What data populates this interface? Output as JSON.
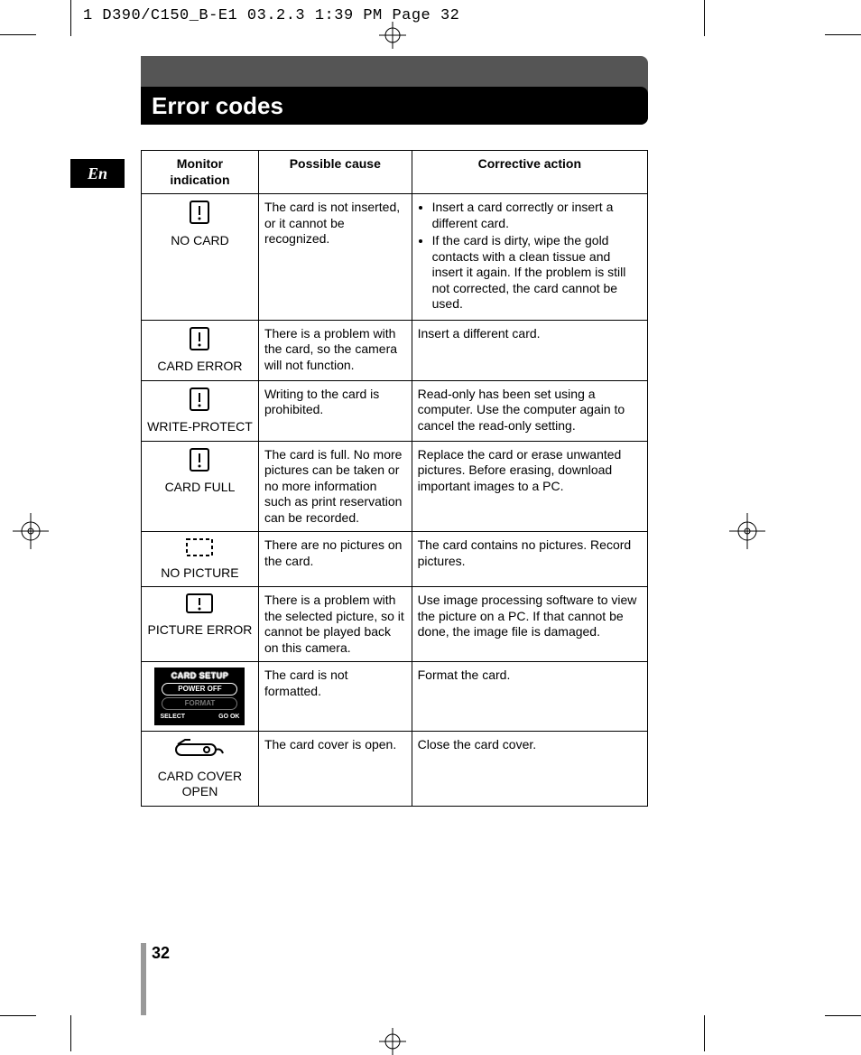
{
  "print_header": "1 D390/C150_B-E1  03.2.3 1:39 PM  Page 32",
  "title": "Error codes",
  "lang_tab": "En",
  "page_number": "32",
  "table": {
    "headers": {
      "monitor": "Monitor indication",
      "cause": "Possible cause",
      "action": "Corrective action"
    },
    "rows": [
      {
        "icon": "warn-card",
        "label": "NO CARD",
        "cause": "The card is not inserted, or it cannot be recognized.",
        "action_bullets": [
          "Insert a card correctly or insert a different card.",
          "If the card is dirty, wipe the gold contacts with a clean tissue and insert it again. If the problem is still not corrected, the card cannot be used."
        ]
      },
      {
        "icon": "warn-card",
        "label": "CARD ERROR",
        "cause": "There is a problem with the card, so the camera will not function.",
        "action": "Insert a different card."
      },
      {
        "icon": "warn-card",
        "label": "WRITE-PROTECT",
        "cause": "Writing to the card is prohibited.",
        "action": "Read-only has been set using a computer. Use the computer again to cancel the read-only setting."
      },
      {
        "icon": "warn-card",
        "label": "CARD FULL",
        "cause": "The card is full. No more pictures can be taken or no more information such as print reservation can be recorded.",
        "action": "Replace the card or erase unwanted pictures. Before erasing, download important images to a PC."
      },
      {
        "icon": "dashed-frame",
        "label": "NO PICTURE",
        "cause": "There are no pictures on the card.",
        "action": "The card contains no pictures. Record pictures."
      },
      {
        "icon": "warn-frame",
        "label": "PICTURE ERROR",
        "cause": "There is a problem with the selected picture, so it cannot be played back on this camera.",
        "action": "Use image processing software to view the picture on a PC. If that cannot be done, the image file is damaged."
      },
      {
        "icon": "card-setup",
        "label": "",
        "cause": "The card is not formatted.",
        "action": "Format the card."
      },
      {
        "icon": "card-cover",
        "label": "CARD COVER OPEN",
        "cause": "The card cover is open.",
        "action": "Close the card cover."
      }
    ]
  },
  "card_setup": {
    "title": "CARD SETUP",
    "opt1": "POWER OFF",
    "opt2": "FORMAT",
    "foot_left": "SELECT",
    "foot_right": "GO  OK"
  }
}
